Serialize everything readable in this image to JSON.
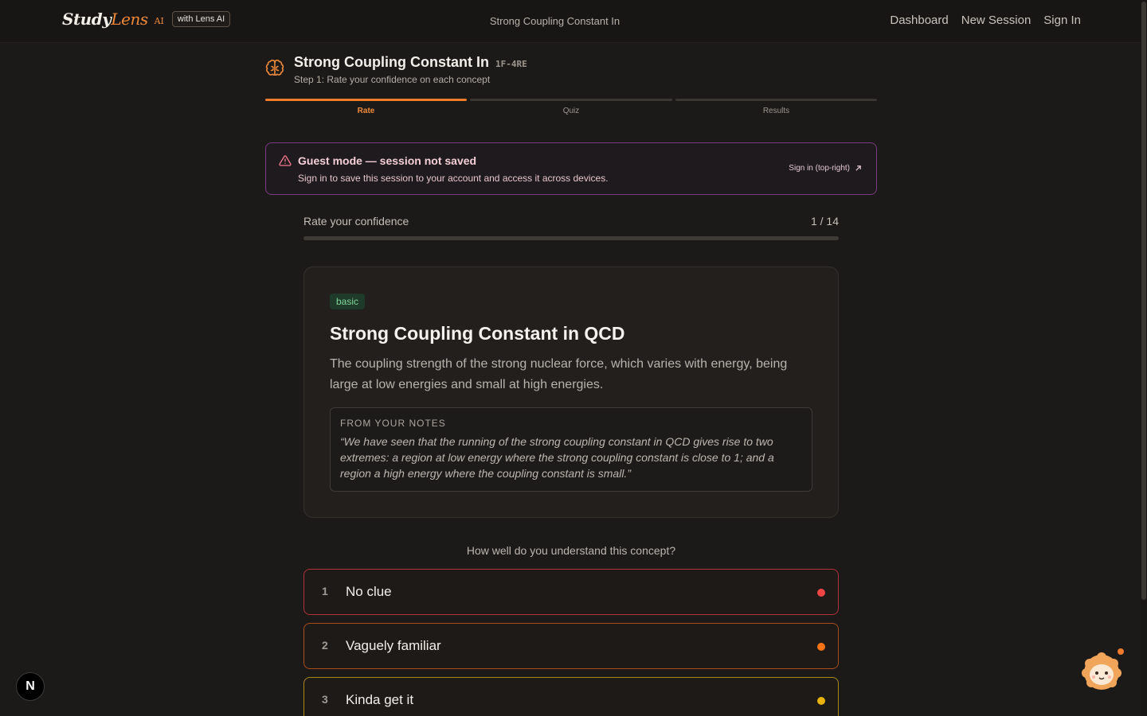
{
  "nav": {
    "brand_study": "Study",
    "brand_lens": "Lens",
    "brand_ai": "AI",
    "brand_pill": "with Lens AI",
    "center_title": "Strong Coupling Constant In",
    "links": [
      "Dashboard",
      "New Session",
      "Sign In"
    ]
  },
  "header": {
    "icon": "brain-icon",
    "title": "Strong Coupling Constant In",
    "code": "1F-4RE",
    "subtitle": "Step 1: Rate your confidence on each concept"
  },
  "stepper": {
    "steps": [
      {
        "label": "Rate",
        "active": true
      },
      {
        "label": "Quiz",
        "active": false
      },
      {
        "label": "Results",
        "active": false
      }
    ]
  },
  "banner": {
    "icon": "warning-icon",
    "title": "Guest mode — session not saved",
    "text": "Sign in to save this session to your account and access it across devices.",
    "link": "Sign in (top-right)",
    "link_icon": "arrow-up-right-icon"
  },
  "progress": {
    "label": "Rate your confidence",
    "count": "1 / 14",
    "fraction": 0.0
  },
  "concept": {
    "badge": "basic",
    "title": "Strong Coupling Constant in QCD",
    "description": "The coupling strength of the strong nuclear force, which varies with energy, being large at low energies and small at high energies.",
    "notes_label": "FROM YOUR NOTES",
    "notes_quote": "“We have seen that the running of the strong coupling constant in QCD gives rise to two extremes: a region at low energy where the strong coupling constant is close to 1; and a region a high energy where the coupling constant is small.”"
  },
  "question": "How well do you understand this concept?",
  "options": [
    {
      "num": "1",
      "label": "No clue",
      "color": "#ef4444",
      "border": "#b4303c"
    },
    {
      "num": "2",
      "label": "Vaguely familiar",
      "color": "#f97316",
      "border": "#a94d1f"
    },
    {
      "num": "3",
      "label": "Kinda get it",
      "color": "#eab308",
      "border": "#a98a10"
    }
  ],
  "floating": {
    "n_badge": "N",
    "mascot": "mascot-icon"
  },
  "colors": {
    "accent": "#f07c2b",
    "banner_border": "#7c3a86",
    "badge_bg": "#1f3a28"
  }
}
